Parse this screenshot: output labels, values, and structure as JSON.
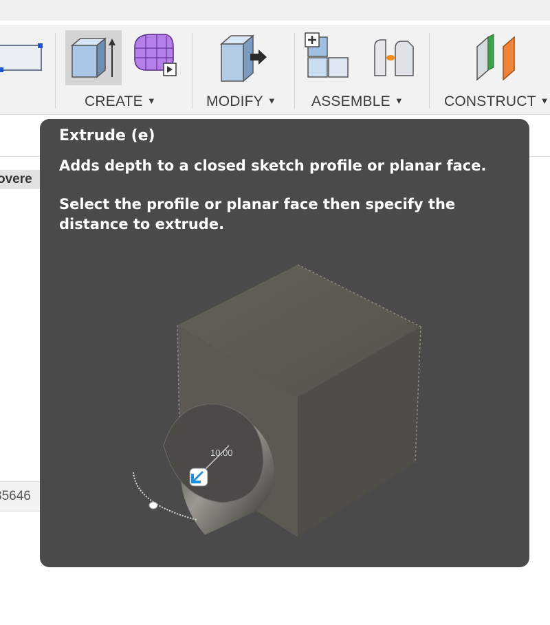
{
  "toolbar": {
    "groups": [
      {
        "label": "CREATE",
        "caret": "▼"
      },
      {
        "label": "MODIFY",
        "caret": "▼"
      },
      {
        "label": "ASSEMBLE",
        "caret": "▼"
      },
      {
        "label": "CONSTRUCT",
        "caret": "▼"
      }
    ],
    "tools": [
      {
        "name": "rectangle-sketch-icon"
      },
      {
        "name": "extrude-icon",
        "active": true
      },
      {
        "name": "form-box-icon"
      },
      {
        "name": "press-pull-icon"
      },
      {
        "name": "new-component-icon"
      },
      {
        "name": "joint-icon"
      },
      {
        "name": "offset-plane-icon"
      }
    ]
  },
  "background": {
    "left_tab_text": "overe",
    "left_field_text": "35646"
  },
  "tooltip": {
    "title": "Extrude (e)",
    "description": "Adds depth to a closed sketch profile or planar face.",
    "detail": "Select the profile or planar face then specify the distance to extrude.",
    "illustration": {
      "dimension_value": "10.00",
      "arrow_color": "#1e8fe0",
      "cube_color": "#59564f"
    }
  }
}
